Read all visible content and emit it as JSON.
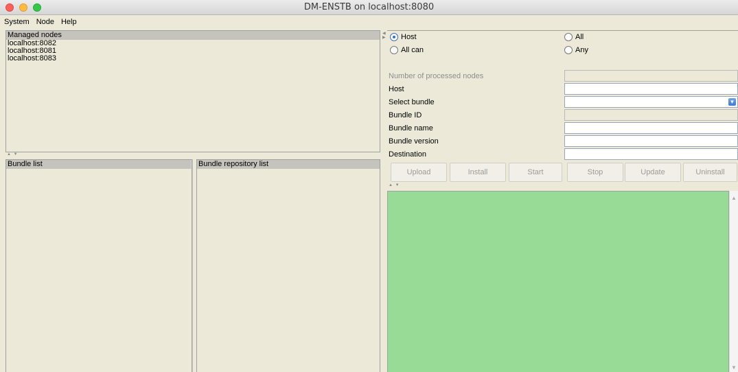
{
  "window": {
    "title": "DM-ENSTB on localhost:8080"
  },
  "menu": [
    "System",
    "Node",
    "Help"
  ],
  "nodes": {
    "header": "Managed nodes",
    "items": [
      "localhost:8082",
      "localhost:8081",
      "localhost:8083"
    ]
  },
  "bundle_list": {
    "header": "Bundle list"
  },
  "repo_list": {
    "header": "Bundle repository list"
  },
  "scope": {
    "host": "Host",
    "all": "All",
    "all_can": "All can",
    "any": "Any",
    "selected": "Host"
  },
  "form": {
    "processed_label": "Number of processed nodes",
    "host_label": "Host",
    "select_bundle_label": "Select bundle",
    "bundle_id_label": "Bundle ID",
    "bundle_name_label": "Bundle name",
    "bundle_version_label": "Bundle version",
    "destination_label": "Destination"
  },
  "buttons": [
    "Upload",
    "Install",
    "Start",
    "Stop",
    "Update",
    "Uninstall"
  ],
  "console": {
    "color": "#97db97"
  }
}
